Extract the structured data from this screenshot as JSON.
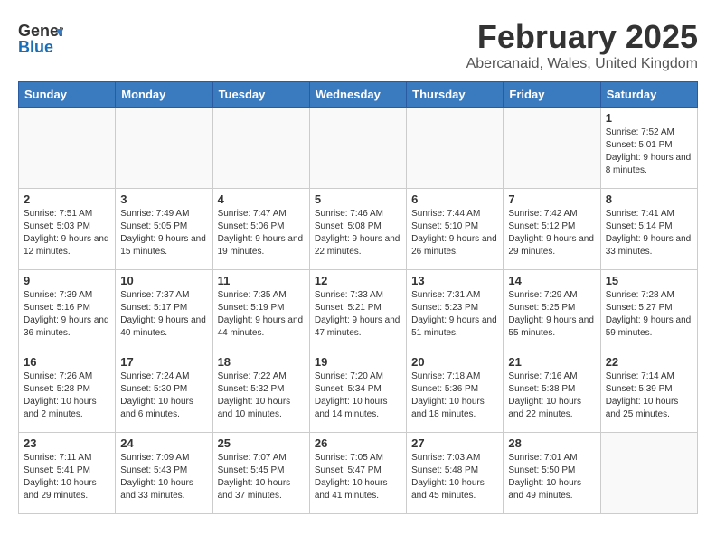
{
  "header": {
    "logo_general": "General",
    "logo_blue": "Blue",
    "main_title": "February 2025",
    "subtitle": "Abercanaid, Wales, United Kingdom"
  },
  "calendar": {
    "weekdays": [
      "Sunday",
      "Monday",
      "Tuesday",
      "Wednesday",
      "Thursday",
      "Friday",
      "Saturday"
    ],
    "weeks": [
      [
        {
          "day": "",
          "info": ""
        },
        {
          "day": "",
          "info": ""
        },
        {
          "day": "",
          "info": ""
        },
        {
          "day": "",
          "info": ""
        },
        {
          "day": "",
          "info": ""
        },
        {
          "day": "",
          "info": ""
        },
        {
          "day": "1",
          "info": "Sunrise: 7:52 AM\nSunset: 5:01 PM\nDaylight: 9 hours and 8 minutes."
        }
      ],
      [
        {
          "day": "2",
          "info": "Sunrise: 7:51 AM\nSunset: 5:03 PM\nDaylight: 9 hours and 12 minutes."
        },
        {
          "day": "3",
          "info": "Sunrise: 7:49 AM\nSunset: 5:05 PM\nDaylight: 9 hours and 15 minutes."
        },
        {
          "day": "4",
          "info": "Sunrise: 7:47 AM\nSunset: 5:06 PM\nDaylight: 9 hours and 19 minutes."
        },
        {
          "day": "5",
          "info": "Sunrise: 7:46 AM\nSunset: 5:08 PM\nDaylight: 9 hours and 22 minutes."
        },
        {
          "day": "6",
          "info": "Sunrise: 7:44 AM\nSunset: 5:10 PM\nDaylight: 9 hours and 26 minutes."
        },
        {
          "day": "7",
          "info": "Sunrise: 7:42 AM\nSunset: 5:12 PM\nDaylight: 9 hours and 29 minutes."
        },
        {
          "day": "8",
          "info": "Sunrise: 7:41 AM\nSunset: 5:14 PM\nDaylight: 9 hours and 33 minutes."
        }
      ],
      [
        {
          "day": "9",
          "info": "Sunrise: 7:39 AM\nSunset: 5:16 PM\nDaylight: 9 hours and 36 minutes."
        },
        {
          "day": "10",
          "info": "Sunrise: 7:37 AM\nSunset: 5:17 PM\nDaylight: 9 hours and 40 minutes."
        },
        {
          "day": "11",
          "info": "Sunrise: 7:35 AM\nSunset: 5:19 PM\nDaylight: 9 hours and 44 minutes."
        },
        {
          "day": "12",
          "info": "Sunrise: 7:33 AM\nSunset: 5:21 PM\nDaylight: 9 hours and 47 minutes."
        },
        {
          "day": "13",
          "info": "Sunrise: 7:31 AM\nSunset: 5:23 PM\nDaylight: 9 hours and 51 minutes."
        },
        {
          "day": "14",
          "info": "Sunrise: 7:29 AM\nSunset: 5:25 PM\nDaylight: 9 hours and 55 minutes."
        },
        {
          "day": "15",
          "info": "Sunrise: 7:28 AM\nSunset: 5:27 PM\nDaylight: 9 hours and 59 minutes."
        }
      ],
      [
        {
          "day": "16",
          "info": "Sunrise: 7:26 AM\nSunset: 5:28 PM\nDaylight: 10 hours and 2 minutes."
        },
        {
          "day": "17",
          "info": "Sunrise: 7:24 AM\nSunset: 5:30 PM\nDaylight: 10 hours and 6 minutes."
        },
        {
          "day": "18",
          "info": "Sunrise: 7:22 AM\nSunset: 5:32 PM\nDaylight: 10 hours and 10 minutes."
        },
        {
          "day": "19",
          "info": "Sunrise: 7:20 AM\nSunset: 5:34 PM\nDaylight: 10 hours and 14 minutes."
        },
        {
          "day": "20",
          "info": "Sunrise: 7:18 AM\nSunset: 5:36 PM\nDaylight: 10 hours and 18 minutes."
        },
        {
          "day": "21",
          "info": "Sunrise: 7:16 AM\nSunset: 5:38 PM\nDaylight: 10 hours and 22 minutes."
        },
        {
          "day": "22",
          "info": "Sunrise: 7:14 AM\nSunset: 5:39 PM\nDaylight: 10 hours and 25 minutes."
        }
      ],
      [
        {
          "day": "23",
          "info": "Sunrise: 7:11 AM\nSunset: 5:41 PM\nDaylight: 10 hours and 29 minutes."
        },
        {
          "day": "24",
          "info": "Sunrise: 7:09 AM\nSunset: 5:43 PM\nDaylight: 10 hours and 33 minutes."
        },
        {
          "day": "25",
          "info": "Sunrise: 7:07 AM\nSunset: 5:45 PM\nDaylight: 10 hours and 37 minutes."
        },
        {
          "day": "26",
          "info": "Sunrise: 7:05 AM\nSunset: 5:47 PM\nDaylight: 10 hours and 41 minutes."
        },
        {
          "day": "27",
          "info": "Sunrise: 7:03 AM\nSunset: 5:48 PM\nDaylight: 10 hours and 45 minutes."
        },
        {
          "day": "28",
          "info": "Sunrise: 7:01 AM\nSunset: 5:50 PM\nDaylight: 10 hours and 49 minutes."
        },
        {
          "day": "",
          "info": ""
        }
      ]
    ]
  }
}
